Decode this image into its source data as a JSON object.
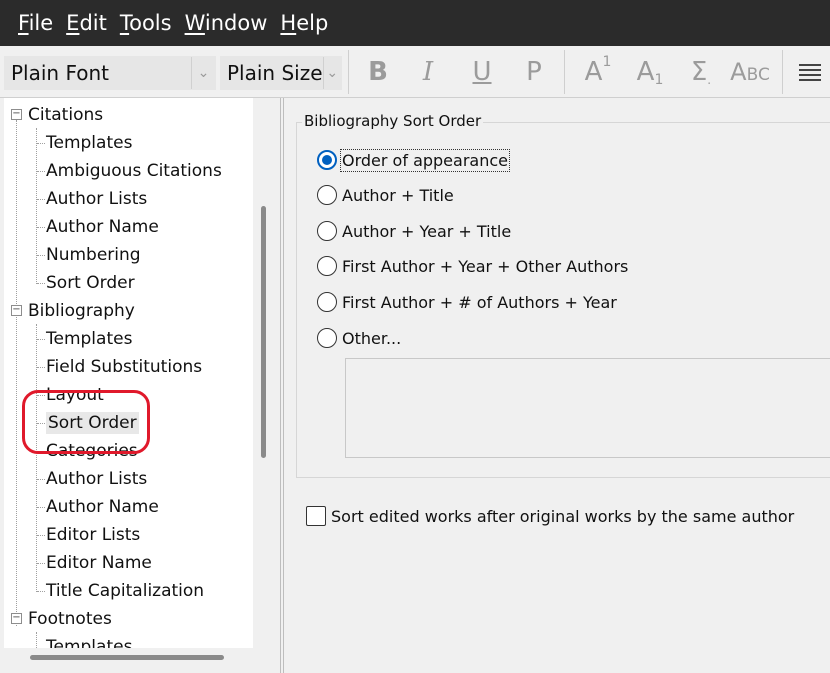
{
  "menu": [
    {
      "name": "file",
      "accel": "F",
      "rest": "ile"
    },
    {
      "name": "edit",
      "accel": "E",
      "rest": "dit"
    },
    {
      "name": "tools",
      "accel": "T",
      "rest": "ools"
    },
    {
      "name": "window",
      "accel": "W",
      "rest": "indow"
    },
    {
      "name": "help",
      "accel": "H",
      "rest": "elp"
    }
  ],
  "toolbar": {
    "font_value": "Plain Font",
    "size_value": "Plain Size",
    "bold": "B",
    "italic": "I",
    "underline": "U",
    "plain": "P",
    "superscript_base": "A",
    "superscript_mark": "1",
    "subscript_base": "A",
    "subscript_mark": "1",
    "sum_symbol": "Σ",
    "small_caps": "Abc"
  },
  "tree": {
    "citations": {
      "label": "Citations",
      "children": [
        "Templates",
        "Ambiguous Citations",
        "Author Lists",
        "Author Name",
        "Numbering",
        "Sort Order"
      ]
    },
    "bibliography": {
      "label": "Bibliography",
      "children": [
        "Templates",
        "Field Substitutions",
        "Layout",
        "Sort Order",
        "Categories",
        "Author Lists",
        "Author Name",
        "Editor Lists",
        "Editor Name",
        "Title Capitalization"
      ]
    },
    "footnotes": {
      "label": "Footnotes",
      "children": [
        "Templates"
      ]
    },
    "selected": "Sort Order"
  },
  "sort_order": {
    "group_title": "Bibliography Sort Order",
    "options": [
      "Order of appearance",
      "Author + Title",
      "Author + Year + Title",
      "First Author + Year + Other Authors",
      "First Author + # of Authors + Year",
      "Other..."
    ],
    "selected_index": 0,
    "sort_edited_label": "Sort edited works after original works by the same author",
    "sort_edited_checked": false
  },
  "colors": {
    "menubar": "#2b2b2b",
    "accent": "#0060c0",
    "highlight_ring": "#e0192b"
  }
}
